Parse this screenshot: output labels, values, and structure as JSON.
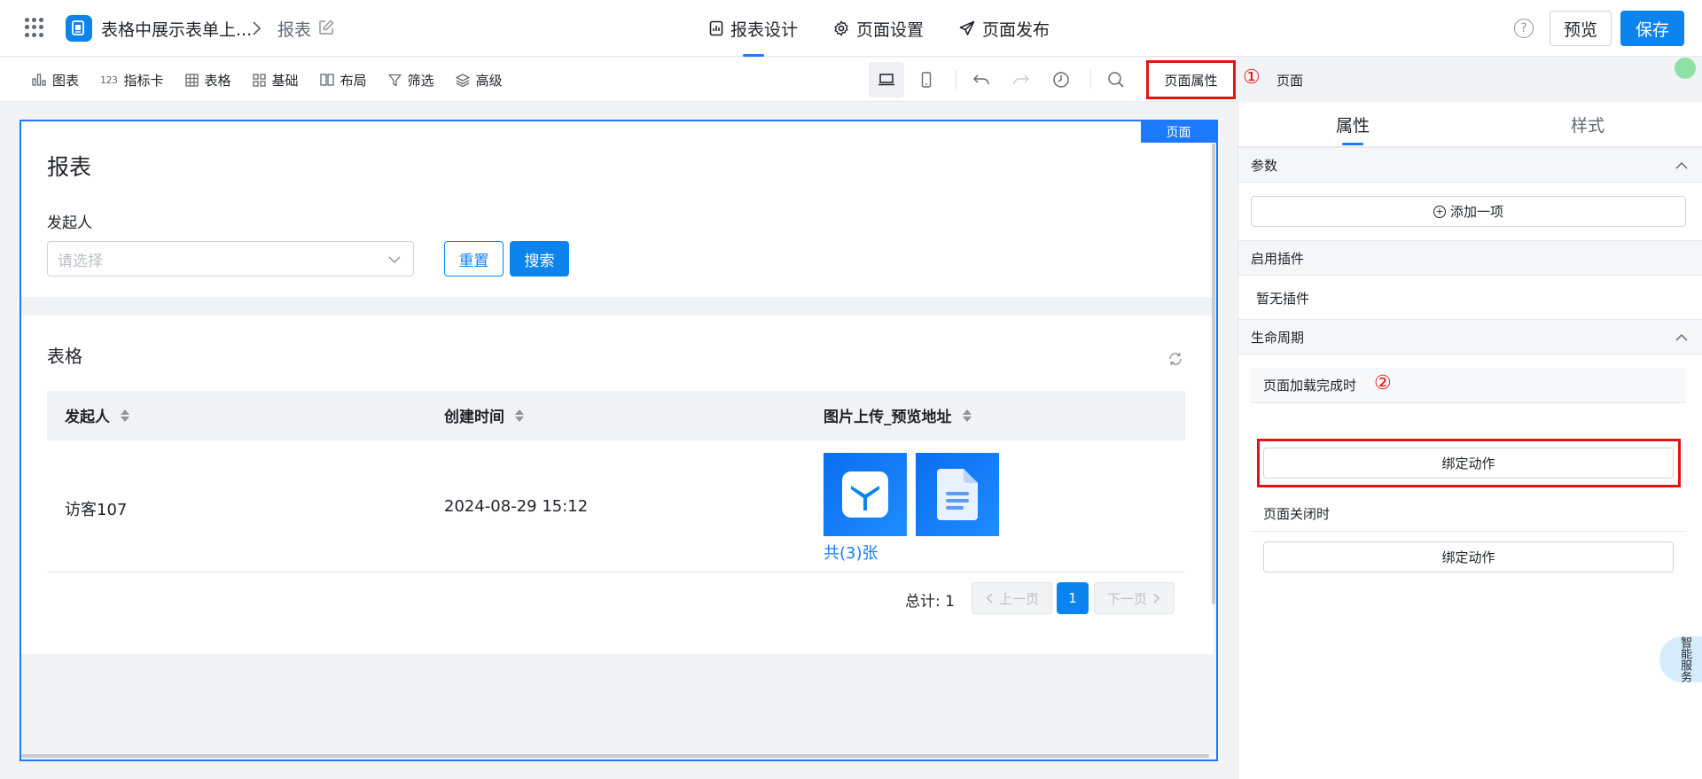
{
  "header": {
    "app_name": "表格中展示表单上...",
    "breadcrumb_page": "报表",
    "tabs": [
      {
        "label": "报表设计",
        "icon": "report-design-icon",
        "active": true
      },
      {
        "label": "页面设置",
        "icon": "gear-icon",
        "active": false
      },
      {
        "label": "页面发布",
        "icon": "paper-plane-icon",
        "active": false
      }
    ],
    "help": "?",
    "preview_label": "预览",
    "save_label": "保存"
  },
  "toolbar": {
    "items": [
      {
        "label": "图表",
        "icon": "bar-chart-icon"
      },
      {
        "label": "指标卡",
        "icon": "number-card-icon",
        "icon_text": "123"
      },
      {
        "label": "表格",
        "icon": "table-grid-icon"
      },
      {
        "label": "基础",
        "icon": "basic-components-icon"
      },
      {
        "label": "布局",
        "icon": "layout-icon"
      },
      {
        "label": "筛选",
        "icon": "filter-icon"
      },
      {
        "label": "高级",
        "icon": "layers-icon"
      }
    ],
    "page_props_label": "页面属性",
    "annotation_1": "①",
    "page_breadcrumb": "页面"
  },
  "canvas": {
    "tag": "页面",
    "report_title": "报表",
    "filter": {
      "label": "发起人",
      "placeholder": "请选择",
      "reset_label": "重置",
      "search_label": "搜索"
    },
    "table": {
      "title": "表格",
      "columns": [
        "发起人",
        "创建时间",
        "图片上传_预览地址"
      ],
      "rows": [
        {
          "initiator": "访客107",
          "created": "2024-08-29 15:12",
          "image_count": "共(3)张"
        }
      ],
      "pager": {
        "total": "总计: 1",
        "prev": "上一页",
        "page": "1",
        "next": "下一页"
      }
    }
  },
  "panel": {
    "tabs": [
      {
        "label": "属性",
        "active": true
      },
      {
        "label": "样式",
        "active": false
      }
    ],
    "params_title": "参数",
    "add_item_label": "添加一项",
    "plugins_title": "启用插件",
    "no_plugins": "暂无插件",
    "lifecycle_title": "生命周期",
    "on_load_label": "页面加载完成时",
    "annotation_2": "②",
    "bind_action_label": "绑定动作",
    "on_close_label": "页面关闭时",
    "bind_action_label_2": "绑定动作"
  },
  "smart_service": "智能服务",
  "colors": {
    "primary": "#0b84ef",
    "accent_border": "#1d7afc",
    "highlight_red": "#e21414"
  }
}
